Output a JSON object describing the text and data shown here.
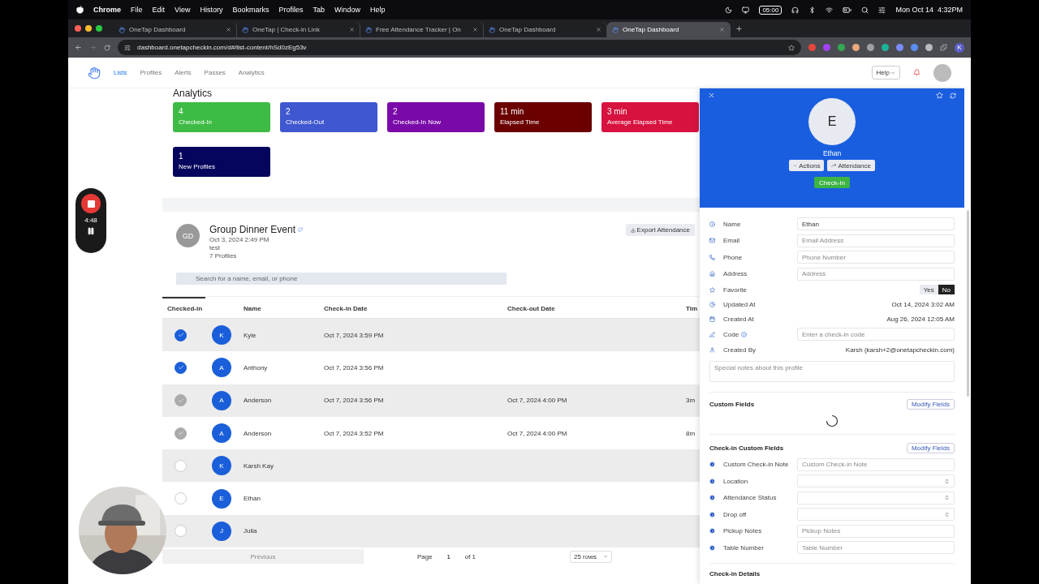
{
  "menu_bar": {
    "app": "Chrome",
    "menus": [
      "File",
      "Edit",
      "View",
      "History",
      "Bookmarks",
      "Profiles",
      "Tab",
      "Window",
      "Help"
    ],
    "timer": "05:00",
    "clock": "Mon Oct 14  4:32PM"
  },
  "browser": {
    "tabs": [
      {
        "title": "OneTap Dashboard",
        "selected": false
      },
      {
        "title": "OneTap | Check-in Link",
        "selected": false
      },
      {
        "title": "Free Attendance Tracker | On",
        "selected": false
      },
      {
        "title": "OneTap Dashboard",
        "selected": false
      },
      {
        "title": "OneTap Dashboard",
        "selected": true
      }
    ],
    "url": "dashboard.onetapcheckin.com/d#/list-content/hSd0zEg53v",
    "profile": "K"
  },
  "nav": {
    "items": [
      {
        "label": "Lists",
        "selected": true
      },
      {
        "label": "Profiles",
        "selected": false
      },
      {
        "label": "Alerts",
        "selected": false
      },
      {
        "label": "Passes",
        "selected": false
      },
      {
        "label": "Analytics",
        "selected": false
      }
    ],
    "help": "Help"
  },
  "analytics": {
    "title": "Analytics",
    "stats": [
      {
        "value": "4",
        "label": "Checked-In",
        "color": "#3dbb44"
      },
      {
        "value": "2",
        "label": "Checked-Out",
        "color": "#3f57cf"
      },
      {
        "value": "2",
        "label": "Checked-In Now",
        "color": "#7a0aa8"
      },
      {
        "value": "11 min",
        "label": "Elapsed Time",
        "color": "#6b0000"
      },
      {
        "value": "3 min",
        "label": "Average Elapsed Time",
        "color": "#d8123f"
      },
      {
        "value": "1",
        "label": "New Profiles",
        "color": "#05055e"
      }
    ]
  },
  "event": {
    "initials": "GD",
    "title": "Group Dinner Event",
    "date": "Oct 3, 2024 2:49 PM",
    "description": "test",
    "count": "7 Profiles",
    "export": "Export Attendance",
    "search": {
      "placeholder": "Search for a name, email, or phone"
    }
  },
  "table": {
    "columns": [
      {
        "label": "Checked-in",
        "selected": true
      },
      {
        "label": "Name",
        "selected": false
      },
      {
        "label": "Check-in Date",
        "selected": false
      },
      {
        "label": "Check-out Date",
        "selected": false
      },
      {
        "label": "Tim",
        "selected": false
      }
    ],
    "rows": [
      {
        "kind": "checked_in",
        "initial": "K",
        "name": "Kyle",
        "check_in": "Oct 7, 2024 3:59 PM"
      },
      {
        "kind": "checked_in",
        "initial": "A",
        "name": "Anthony",
        "check_in": "Oct 7, 2024 3:56 PM"
      },
      {
        "kind": "checked_out",
        "initial": "A",
        "name": "Anderson",
        "check_in": "Oct 7, 2024 3:56 PM",
        "check_out": "Oct 7, 2024 4:00 PM",
        "column_6": "3m"
      },
      {
        "kind": "checked_out",
        "initial": "A",
        "name": "Anderson",
        "check_in": "Oct 7, 2024 3:52 PM",
        "check_out": "Oct 7, 2024 4:00 PM",
        "column_6": "8m"
      },
      {
        "kind": "none",
        "initial": "K",
        "name": "Karsh Kay"
      },
      {
        "kind": "none",
        "initial": "E",
        "name": "Ethan"
      },
      {
        "kind": "none",
        "initial": "J",
        "name": "Julia"
      }
    ],
    "pagination": {
      "previous": "Previous",
      "page_label": "Page",
      "page": "1",
      "of": "of 1",
      "rows": "25 rows"
    }
  },
  "profile_panel": {
    "initial": "E",
    "name": "Ethan",
    "actions": "Actions",
    "attendance": "Attendance",
    "check_in": "Check-In",
    "fields": [
      {
        "kind": "input",
        "label": "Name",
        "value": "Ethan"
      },
      {
        "kind": "input",
        "label": "Email",
        "placeholder": "Email Address"
      },
      {
        "kind": "input",
        "label": "Phone",
        "placeholder": "Phone Number"
      },
      {
        "kind": "input",
        "label": "Address",
        "placeholder": "Address"
      },
      {
        "kind": "toggle",
        "label": "Favorite",
        "options": [
          {
            "label": "Yes",
            "selected": false
          },
          {
            "label": "No",
            "selected": true
          }
        ]
      },
      {
        "kind": "text",
        "label": "Updated At",
        "value": "Oct 14, 2024 3:02 AM"
      },
      {
        "kind": "text",
        "label": "Created At",
        "value": "Aug 26, 2024 12:05 AM"
      },
      {
        "kind": "input",
        "label": "Code",
        "info": true,
        "placeholder": "Enter a check-in code"
      },
      {
        "kind": "text",
        "label": "Created By",
        "value": "Karsh (karsh+2@onetapcheckin.com)"
      }
    ],
    "notes": {
      "placeholder": "Special notes about this profile"
    },
    "custom_fields": {
      "title": "Custom Fields",
      "button": "Modify Fields",
      "loading": true
    },
    "checkin_custom_fields": {
      "title": "Check-in Custom Fields",
      "button": "Modify Fields",
      "fields": [
        {
          "kind": "input",
          "label": "Custom Check-in Note",
          "placeholder": "Custom Check-in Note"
        },
        {
          "kind": "select",
          "label": "Location"
        },
        {
          "kind": "select",
          "label": "Attendance Status"
        },
        {
          "kind": "select",
          "label": "Drop off"
        },
        {
          "kind": "input",
          "label": "Pickup Notes",
          "placeholder": "Pickup Notes"
        },
        {
          "kind": "input",
          "label": "Table Number",
          "placeholder": "Table Number"
        }
      ]
    },
    "checkin_details": {
      "title": "Check-in Details"
    }
  },
  "recorder": {
    "time": "4:48"
  }
}
